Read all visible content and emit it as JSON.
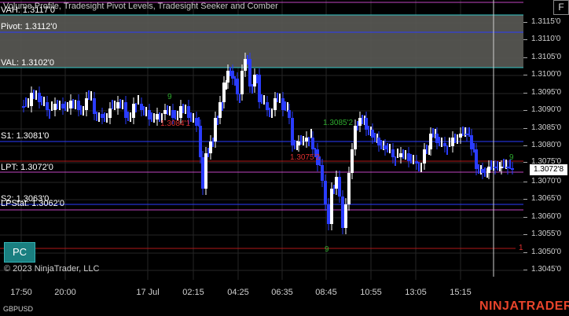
{
  "chart": {
    "title": "Volume Profile, Tradesight Pivot Levels, Tradesight Seeker and Comber",
    "instrument": "GBPUSD",
    "copyright": "© 2023 NinjaTrader, LLC",
    "brand": "NINJATRADER",
    "f_button": "F",
    "pc_button": "PC",
    "current_price": "1.3072'8"
  },
  "levels": {
    "vah": "VAH: 1.3117'0",
    "pivot": "Pivot: 1.3112'0",
    "val": "VAL: 1.3102'0",
    "s1": "S1: 1.3081'0",
    "lpt": "LPT: 1.3072'0",
    "s2": "S2: 1.3063'0",
    "lp_stat": "LPStat: 1.3062'0"
  },
  "markers": {
    "m1": "1.3084'1",
    "m2": "1.3085'2",
    "m3": "1.3075'2",
    "num_1": "1",
    "nine_1": "9",
    "nine_2": "9",
    "nine_3": "9"
  },
  "yaxis": [
    "1.3115'0",
    "1.3110'0",
    "1.3105'0",
    "1.3100'0",
    "1.3095'0",
    "1.3090'0",
    "1.3085'0",
    "1.3080'0",
    "1.3075'0",
    "1.3070'0",
    "1.3065'0",
    "1.3060'0",
    "1.3055'0",
    "1.3050'0",
    "1.3045'0"
  ],
  "xaxis": [
    "17:50",
    "20:00",
    "17 Jul",
    "02:15",
    "04:25",
    "06:35",
    "08:45",
    "10:55",
    "13:05",
    "15:15"
  ],
  "colors": {
    "background": "#000000",
    "up_bar": "#ffffff",
    "down_bar": "#2a3cff",
    "value_area": "#5a5a55",
    "cyan_line": "#35c9c9",
    "blue_line": "#2a3cff",
    "magenta_line": "#c045c0",
    "red_line": "#b01818",
    "grid": "#262626"
  }
}
